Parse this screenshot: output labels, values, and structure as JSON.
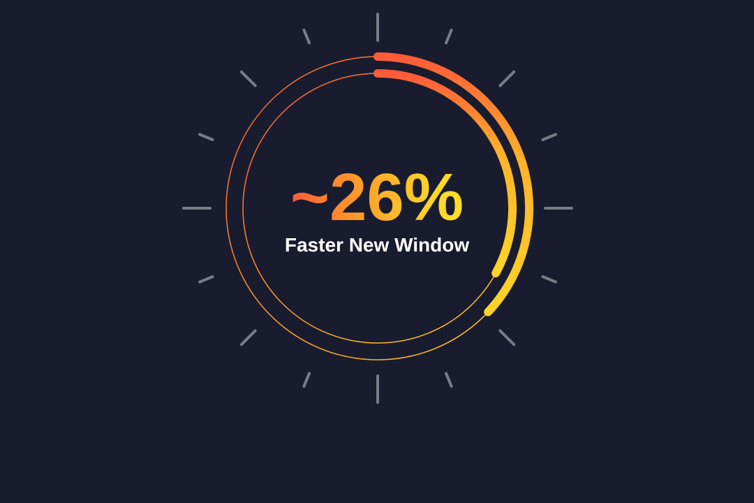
{
  "metric": {
    "value_text": "~26%",
    "caption": "Faster New Window"
  },
  "gauge": {
    "outer_progress": 0.37,
    "inner_progress": 0.33
  },
  "colors": {
    "background": "#191c2e",
    "gradient_start": "#ff5a3a",
    "gradient_end": "#ffe02a",
    "tick": "#8a8c9a",
    "caption": "#ffffff"
  }
}
